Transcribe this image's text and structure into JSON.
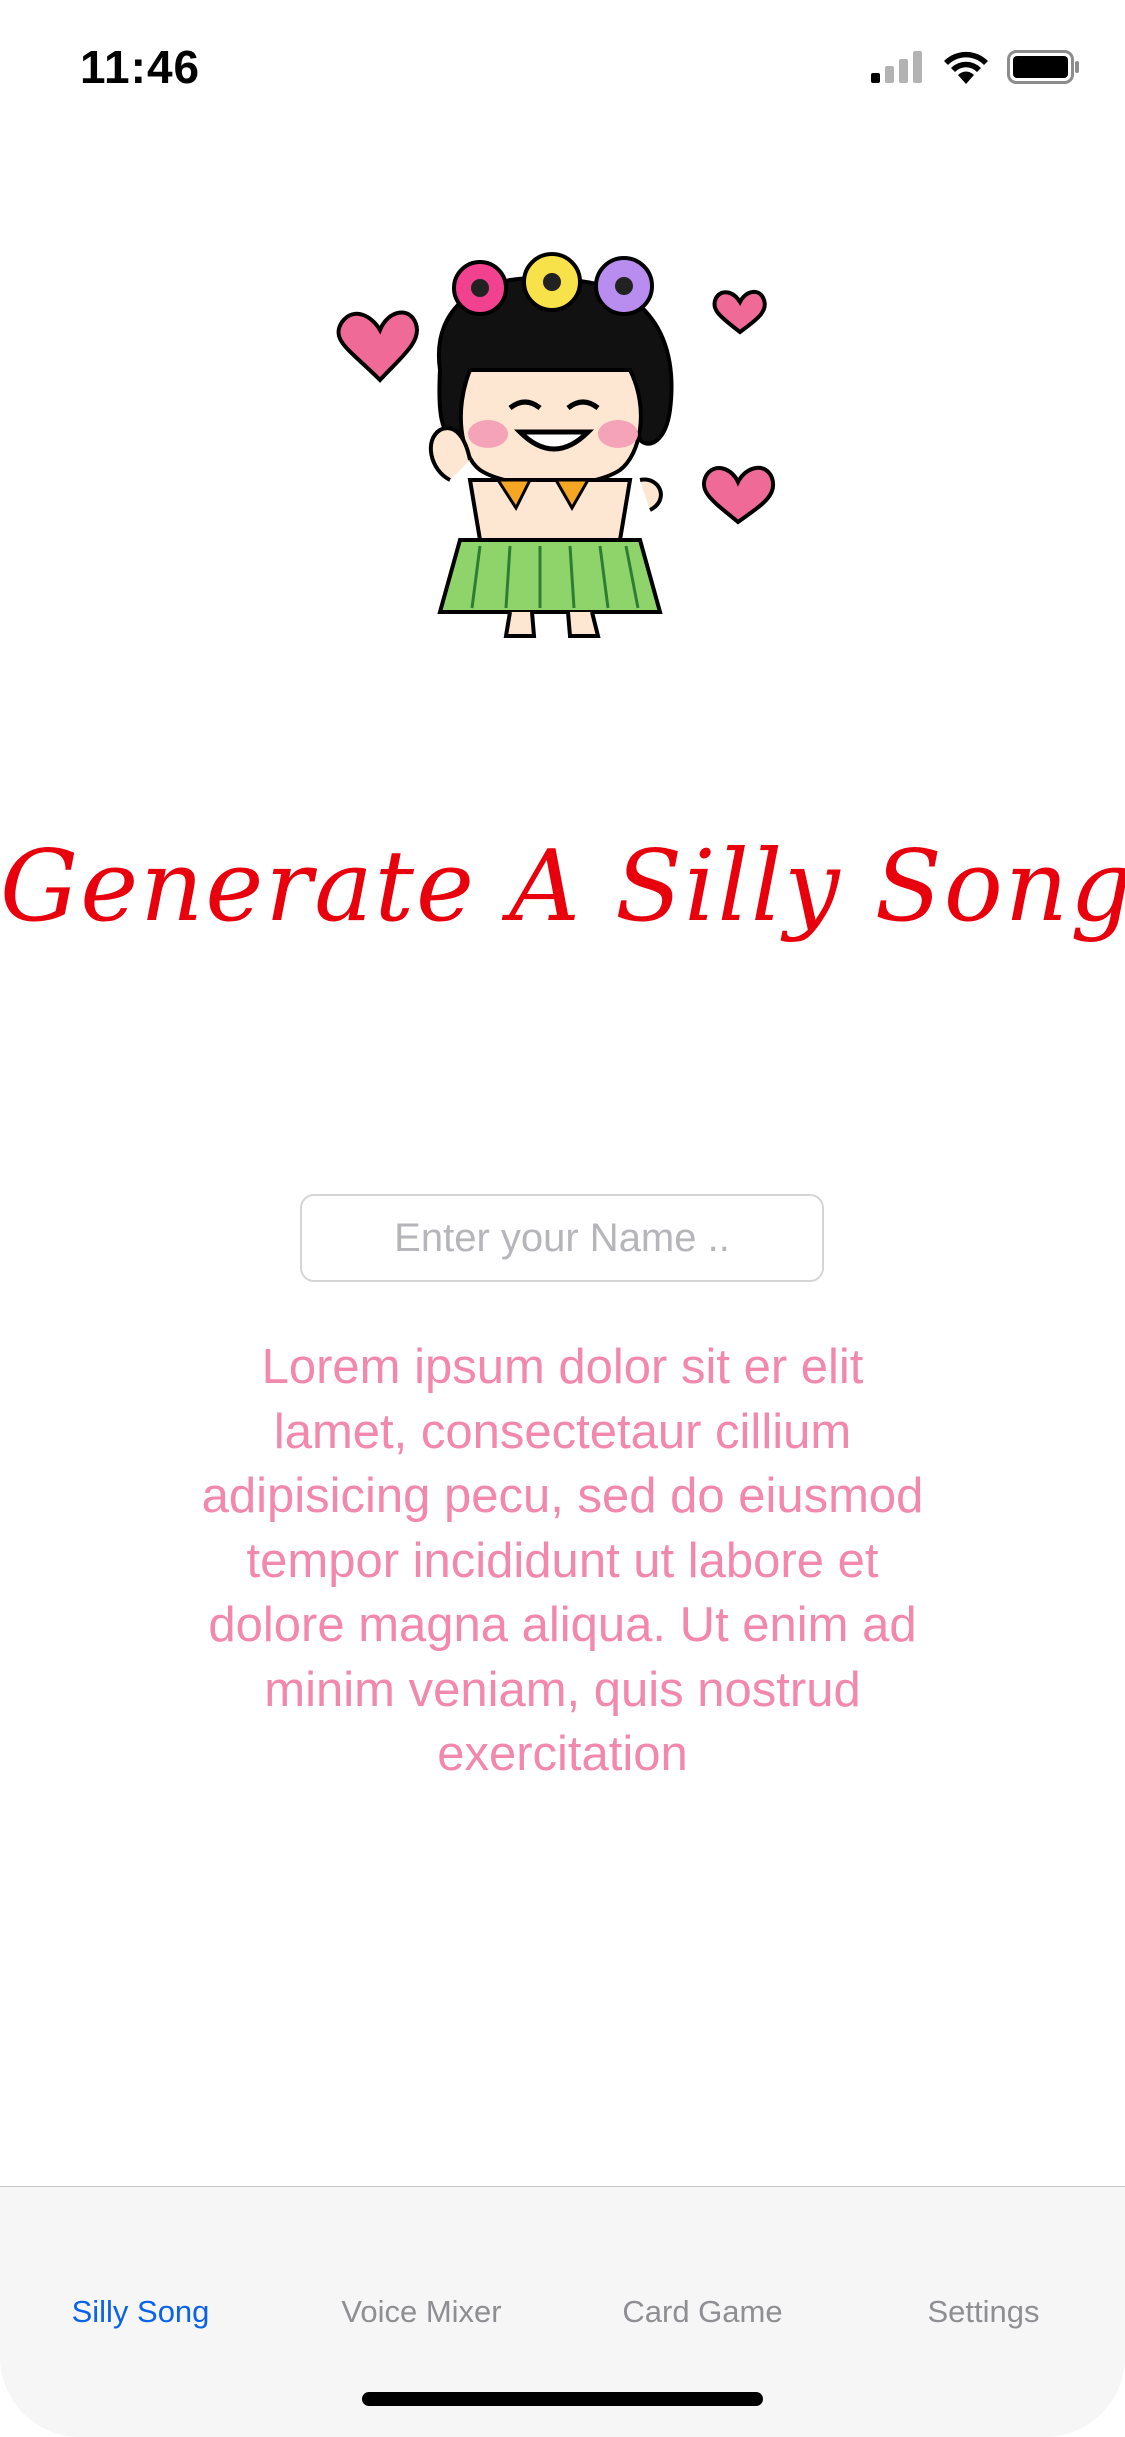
{
  "status_bar": {
    "time": "11:46"
  },
  "main": {
    "title": "Generate A Silly Song!",
    "name_input": {
      "placeholder": "Enter your Name ..",
      "value": ""
    },
    "lorem_text": "Lorem ipsum dolor sit er elit lamet, consectetaur cillium adipisicing pecu, sed do eiusmod tempor incididunt ut labore et dolore magna aliqua. Ut enim ad minim veniam, quis nostrud exercitation"
  },
  "tab_bar": {
    "tabs": [
      {
        "label": "Silly Song",
        "active": true
      },
      {
        "label": "Voice Mixer",
        "active": false
      },
      {
        "label": "Card Game",
        "active": false
      },
      {
        "label": "Settings",
        "active": false
      }
    ]
  },
  "colors": {
    "title": "#e8000d",
    "lorem": "#f288ab",
    "tab_active": "#0a62e8",
    "tab_inactive": "#8e8e93"
  }
}
